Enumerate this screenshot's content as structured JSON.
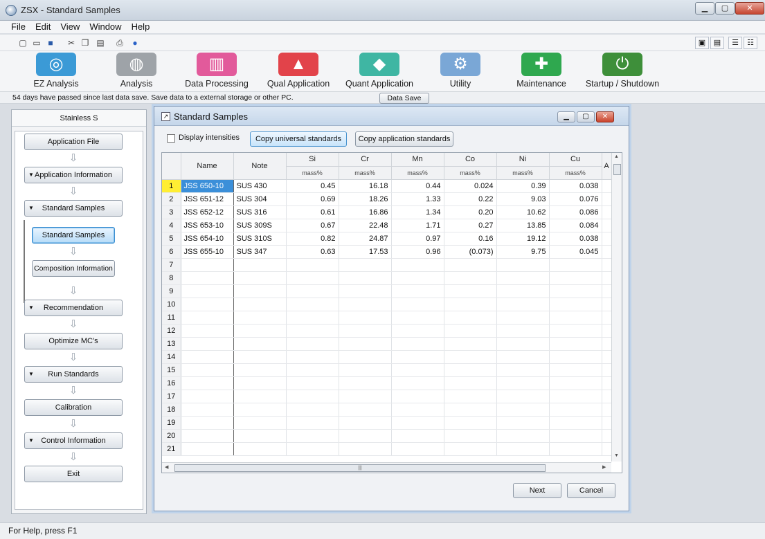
{
  "window": {
    "title": "ZSX - Standard Samples",
    "min": "▁",
    "max": "▢",
    "close": "✕"
  },
  "menu": [
    "File",
    "Edit",
    "View",
    "Window",
    "Help"
  ],
  "toolbar_icons": [
    "new-file-icon",
    "open-folder-icon",
    "save-icon",
    "cut-icon",
    "copy-icon",
    "paste-icon",
    "print-icon",
    "help-icon"
  ],
  "big_tools": [
    {
      "label": "EZ Analysis",
      "icon": "ez-analysis-icon",
      "color": "#3b9ad6"
    },
    {
      "label": "Analysis",
      "icon": "analysis-icon",
      "color": "#9ea3a8"
    },
    {
      "label": "Data Processing",
      "icon": "data-processing-icon",
      "color": "#e25a9b"
    },
    {
      "label": "Qual Application",
      "icon": "qual-application-icon",
      "color": "#e2434a"
    },
    {
      "label": "Quant Application",
      "icon": "quant-application-icon",
      "color": "#3fb6a3"
    },
    {
      "label": "Utility",
      "icon": "utility-icon",
      "color": "#7aa7d6"
    },
    {
      "label": "Maintenance",
      "icon": "maintenance-icon",
      "color": "#2fa84f"
    },
    {
      "label": "Startup / Shutdown",
      "icon": "startup-shutdown-icon",
      "color": "#3e8f3a"
    }
  ],
  "message": {
    "text": "54 days have passed since last data save. Save data to a external storage or other PC.",
    "button": "Data Save"
  },
  "left_panel": {
    "title": "Stainless S",
    "steps": {
      "application_file": "Application File",
      "application_information": "Application Information",
      "standard_samples_group": "Standard Samples",
      "standard_samples": "Standard Samples",
      "composition_information": "Composition Information",
      "recommendation": "Recommendation",
      "optimize": "Optimize MC's",
      "run_standards": "Run Standards",
      "calibration": "Calibration",
      "control_information": "Control Information",
      "exit": "Exit"
    }
  },
  "dialog": {
    "title": "Standard Samples",
    "display_intensities": "Display intensities",
    "copy_universal": "Copy universal standards",
    "copy_application": "Copy application standards",
    "next": "Next",
    "cancel": "Cancel",
    "columns": {
      "name": "Name",
      "note": "Note",
      "elements": [
        "Si",
        "Cr",
        "Mn",
        "Co",
        "Ni",
        "Cu"
      ],
      "unit": "mass%",
      "partial": "A"
    },
    "rows": [
      {
        "n": "1",
        "name": "JSS 650-10",
        "note": "SUS 430",
        "v": [
          "0.45",
          "16.18",
          "0.44",
          "0.024",
          "0.39",
          "0.038"
        ]
      },
      {
        "n": "2",
        "name": "JSS 651-12",
        "note": "SUS 304",
        "v": [
          "0.69",
          "18.26",
          "1.33",
          "0.22",
          "9.03",
          "0.076"
        ]
      },
      {
        "n": "3",
        "name": "JSS 652-12",
        "note": "SUS 316",
        "v": [
          "0.61",
          "16.86",
          "1.34",
          "0.20",
          "10.62",
          "0.086"
        ]
      },
      {
        "n": "4",
        "name": "JSS 653-10",
        "note": "SUS 309S",
        "v": [
          "0.67",
          "22.48",
          "1.71",
          "0.27",
          "13.85",
          "0.084"
        ]
      },
      {
        "n": "5",
        "name": "JSS 654-10",
        "note": "SUS 310S",
        "v": [
          "0.82",
          "24.87",
          "0.97",
          "0.16",
          "19.12",
          "0.038"
        ]
      },
      {
        "n": "6",
        "name": "JSS 655-10",
        "note": "SUS 347",
        "v": [
          "0.63",
          "17.53",
          "0.96",
          "(0.073)",
          "9.75",
          "0.045"
        ]
      },
      {
        "n": "7",
        "name": "",
        "note": "",
        "v": [
          "",
          "",
          "",
          "",
          "",
          ""
        ]
      },
      {
        "n": "8",
        "name": "",
        "note": "",
        "v": [
          "",
          "",
          "",
          "",
          "",
          ""
        ]
      },
      {
        "n": "9",
        "name": "",
        "note": "",
        "v": [
          "",
          "",
          "",
          "",
          "",
          ""
        ]
      },
      {
        "n": "10",
        "name": "",
        "note": "",
        "v": [
          "",
          "",
          "",
          "",
          "",
          ""
        ]
      },
      {
        "n": "11",
        "name": "",
        "note": "",
        "v": [
          "",
          "",
          "",
          "",
          "",
          ""
        ]
      },
      {
        "n": "12",
        "name": "",
        "note": "",
        "v": [
          "",
          "",
          "",
          "",
          "",
          ""
        ]
      },
      {
        "n": "13",
        "name": "",
        "note": "",
        "v": [
          "",
          "",
          "",
          "",
          "",
          ""
        ]
      },
      {
        "n": "14",
        "name": "",
        "note": "",
        "v": [
          "",
          "",
          "",
          "",
          "",
          ""
        ]
      },
      {
        "n": "15",
        "name": "",
        "note": "",
        "v": [
          "",
          "",
          "",
          "",
          "",
          ""
        ]
      },
      {
        "n": "16",
        "name": "",
        "note": "",
        "v": [
          "",
          "",
          "",
          "",
          "",
          ""
        ]
      },
      {
        "n": "17",
        "name": "",
        "note": "",
        "v": [
          "",
          "",
          "",
          "",
          "",
          ""
        ]
      },
      {
        "n": "18",
        "name": "",
        "note": "",
        "v": [
          "",
          "",
          "",
          "",
          "",
          ""
        ]
      },
      {
        "n": "19",
        "name": "",
        "note": "",
        "v": [
          "",
          "",
          "",
          "",
          "",
          ""
        ]
      },
      {
        "n": "20",
        "name": "",
        "note": "",
        "v": [
          "",
          "",
          "",
          "",
          "",
          ""
        ]
      },
      {
        "n": "21",
        "name": "",
        "note": "",
        "v": [
          "",
          "",
          "",
          "",
          "",
          ""
        ]
      }
    ]
  },
  "status": "For Help, press F1"
}
